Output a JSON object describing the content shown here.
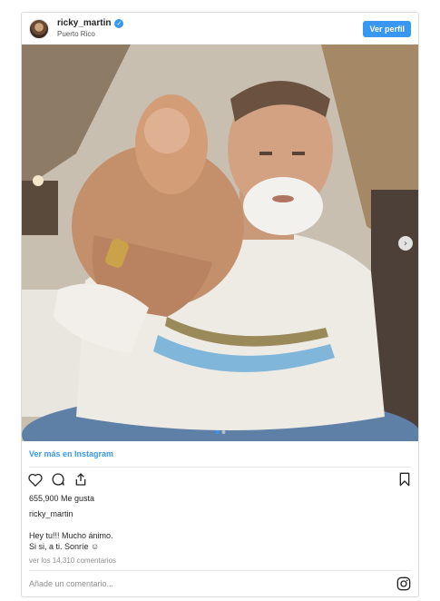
{
  "header": {
    "username": "ricky_martin",
    "location": "Puerto Rico",
    "profile_button": "Ver perfil",
    "verified_icon": "check-icon"
  },
  "photo": {
    "carousel_index": 1,
    "carousel_count": 2
  },
  "view_more": "Ver más en Instagram",
  "likes": "655,900 Me gusta",
  "caption": {
    "author": "ricky_martin",
    "line1": "Hey tu!!! Mucho ánimo.",
    "line2": "Si si, a ti. Sonríe ☺"
  },
  "comments_link": "ver los 14,310 comentarios",
  "comment_placeholder": "Añade un comentario...",
  "colors": {
    "accent": "#3897f0",
    "border": "#dbdbdb",
    "muted": "#8e8e8e"
  }
}
